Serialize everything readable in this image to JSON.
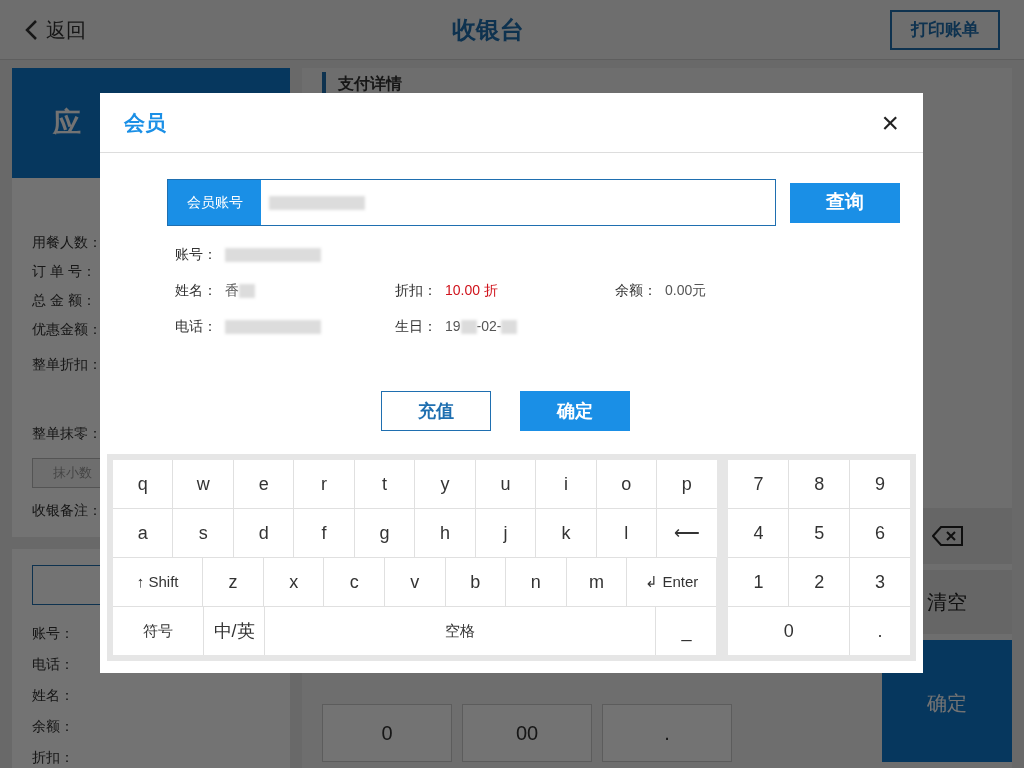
{
  "header": {
    "back": "返回",
    "title": "收银台",
    "print_button": "打印账单"
  },
  "summary_card": {
    "title": "应"
  },
  "order_fields": [
    {
      "label": "用餐人数："
    },
    {
      "label": "订 单 号："
    },
    {
      "label": "总 金 额："
    },
    {
      "label": "优惠金额："
    },
    {
      "label": "整单折扣："
    },
    {
      "label": "整单抹零："
    }
  ],
  "round_button": "抹小数",
  "remark_label": "收银备注：",
  "member_fields": [
    "账号：",
    "电话：",
    "姓名：",
    "余额：",
    "折扣："
  ],
  "payment": {
    "title": "支付详情"
  },
  "keypad": {
    "keys": [
      "0",
      "00",
      "."
    ],
    "clear": "清空",
    "confirm": "确定"
  },
  "dialog": {
    "title": "会员",
    "close": "×",
    "search": {
      "label": "会员账号",
      "value": [
        {
          "kind": "blurred"
        }
      ]
    },
    "query_button": "查询",
    "info_rows": [
      [
        {
          "label": "账号：",
          "value": [
            {
              "kind": "blurred"
            }
          ]
        }
      ],
      [
        {
          "label": "姓名：",
          "value": [
            {
              "kind": "text",
              "text": "香"
            },
            {
              "kind": "blurred"
            }
          ]
        },
        {
          "label": "折扣：",
          "highlight": true,
          "value": [
            {
              "kind": "text",
              "text": "10.00 折"
            }
          ]
        },
        {
          "label": "余额：",
          "highlight": false,
          "value": [
            {
              "kind": "text",
              "text": "0.00元"
            }
          ]
        }
      ],
      [
        {
          "label": "电话：",
          "value": [
            {
              "kind": "blurred"
            }
          ]
        },
        {
          "label": "生日：",
          "highlight": false,
          "value": [
            {
              "kind": "text",
              "text": "19"
            },
            {
              "kind": "blurred"
            },
            {
              "kind": "text",
              "text": "-02-"
            },
            {
              "kind": "blurred"
            }
          ]
        }
      ]
    ],
    "buttons": [
      {
        "label": "充值",
        "kind": "outline"
      },
      {
        "label": "确定",
        "kind": "primary"
      }
    ],
    "letter_rows": [
      [
        {
          "label": "q",
          "kind": "char"
        },
        {
          "label": "w",
          "kind": "char"
        },
        {
          "label": "e",
          "kind": "char"
        },
        {
          "label": "r",
          "kind": "char"
        },
        {
          "label": "t",
          "kind": "char"
        },
        {
          "label": "y",
          "kind": "char"
        },
        {
          "label": "u",
          "kind": "char"
        },
        {
          "label": "i",
          "kind": "char"
        },
        {
          "label": "o",
          "kind": "char"
        },
        {
          "label": "p",
          "kind": "char"
        }
      ],
      [
        {
          "label": "a",
          "kind": "char"
        },
        {
          "label": "s",
          "kind": "char"
        },
        {
          "label": "d",
          "kind": "char"
        },
        {
          "label": "f",
          "kind": "char"
        },
        {
          "label": "g",
          "kind": "char"
        },
        {
          "label": "h",
          "kind": "char"
        },
        {
          "label": "j",
          "kind": "char"
        },
        {
          "label": "k",
          "kind": "char"
        },
        {
          "label": "l",
          "kind": "char"
        },
        {
          "label": "⟵",
          "kind": "char"
        }
      ],
      [
        {
          "label": "↑ Shift",
          "kind": "function"
        },
        {
          "label": "z",
          "kind": "char"
        },
        {
          "label": "x",
          "kind": "char"
        },
        {
          "label": "c",
          "kind": "char"
        },
        {
          "label": "v",
          "kind": "char"
        },
        {
          "label": "b",
          "kind": "char"
        },
        {
          "label": "n",
          "kind": "char"
        },
        {
          "label": "m",
          "kind": "char"
        },
        {
          "label": "↲ Enter",
          "kind": "function"
        }
      ],
      [
        {
          "label": "符号",
          "kind": "function"
        },
        {
          "label": "中/英",
          "kind": "char"
        },
        {
          "label": "空格",
          "kind": "space"
        },
        {
          "label": "_",
          "kind": "char"
        }
      ]
    ],
    "number_rows": [
      [
        {
          "label": "7",
          "kind": "char"
        },
        {
          "label": "8",
          "kind": "char"
        },
        {
          "label": "9",
          "kind": "char"
        }
      ],
      [
        {
          "label": "4",
          "kind": "char"
        },
        {
          "label": "5",
          "kind": "char"
        },
        {
          "label": "6",
          "kind": "char"
        }
      ],
      [
        {
          "label": "1",
          "kind": "char"
        },
        {
          "label": "2",
          "kind": "char"
        },
        {
          "label": "3",
          "kind": "char"
        }
      ],
      [
        {
          "label": "0",
          "kind": "wide"
        },
        {
          "label": ".",
          "kind": "char"
        }
      ]
    ]
  }
}
